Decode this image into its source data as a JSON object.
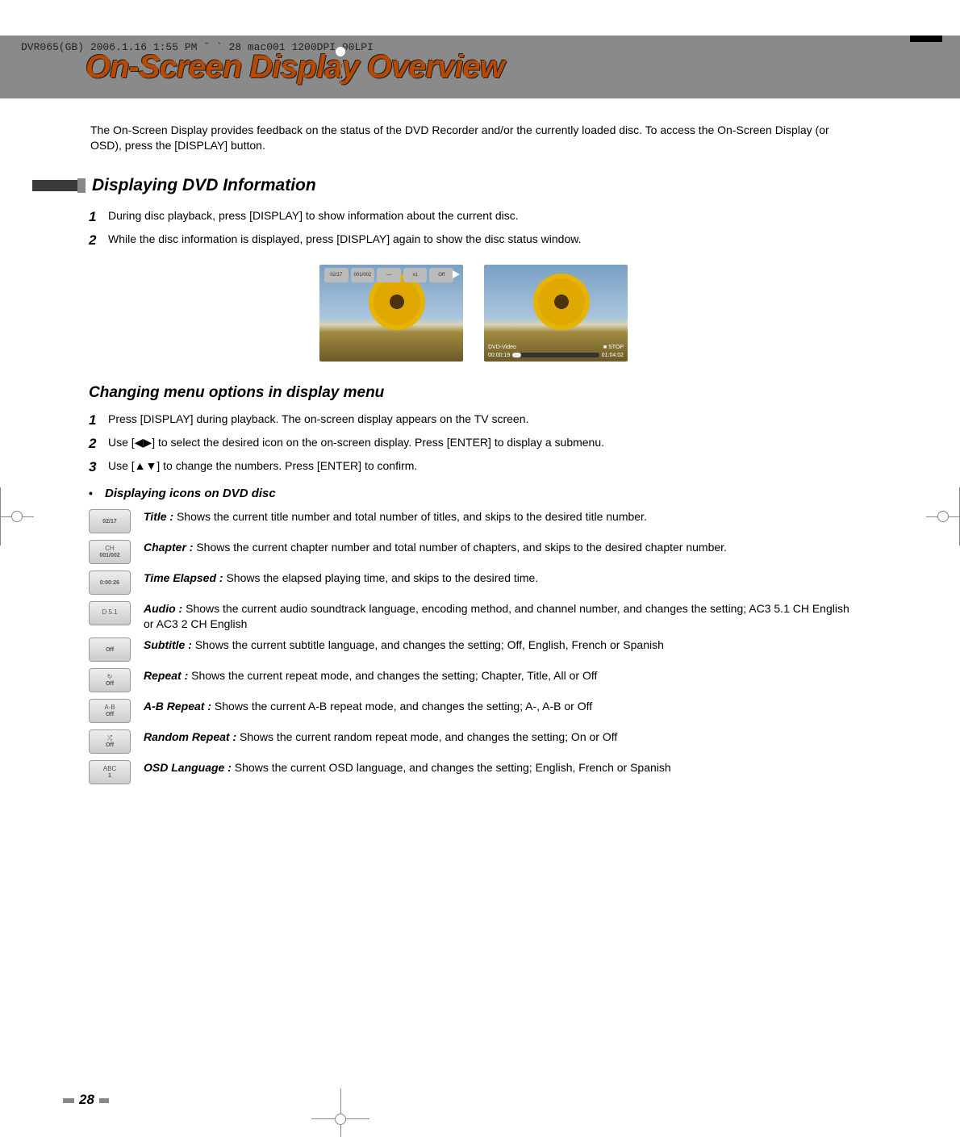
{
  "print_header": "DVR065(GB)  2006.1.16 1:55 PM  ˘   ` 28   mac001  1200DPI 90LPI",
  "title": "On-Screen Display Overview",
  "intro": "The On-Screen Display provides feedback on the status of the DVD Recorder and/or the currently loaded disc. To access the On-Screen Display (or OSD), press the [DISPLAY] button.",
  "section1": {
    "heading": "Displaying DVD Information",
    "steps": [
      {
        "num": "1",
        "text": "During disc playback, press [DISPLAY] to show information about the current disc."
      },
      {
        "num": "2",
        "text": "While the disc information is displayed, press [DISPLAY] again to show the disc status window."
      }
    ]
  },
  "screens": {
    "left_chips": [
      "02/17",
      "001/002",
      "—",
      "x1",
      "Off"
    ],
    "right_bottom_left": "DVD-Video",
    "right_bottom_right": "■ STOP",
    "right_time_left": "00:00:19",
    "right_time_right": "01:04:02"
  },
  "section2": {
    "heading": "Changing menu options in display menu",
    "steps": [
      {
        "num": "1",
        "text": "Press [DISPLAY] during playback. The on-screen display appears on the TV screen."
      },
      {
        "num": "2",
        "text": "Use [◀▶] to select the desired icon on the on-screen display. Press [ENTER] to display a submenu."
      },
      {
        "num": "3",
        "text": "Use [▲▼] to change the numbers. Press [ENTER] to confirm."
      }
    ],
    "bullet": "Displaying icons on DVD disc"
  },
  "defs": [
    {
      "icon_top": "",
      "icon_sub": "02/17",
      "term": "Title :",
      "desc": "  Shows the current title number and total number of titles, and skips to the desired title number."
    },
    {
      "icon_top": "CH",
      "icon_sub": "001/002",
      "term": "Chapter :",
      "desc": "  Shows the current chapter number and total number of chapters, and skips to the desired chapter number."
    },
    {
      "icon_top": "",
      "icon_sub": "0:00:26",
      "term": "Time Elapsed  :",
      "desc": "  Shows the elapsed playing time, and skips to the desired time."
    },
    {
      "icon_top": "D 5.1",
      "icon_sub": "",
      "term": "Audio :",
      "desc": "  Shows the current audio soundtrack language, encoding method, and channel number, and changes the setting; AC3 5.1 CH English or AC3 2 CH English"
    },
    {
      "icon_top": "",
      "icon_sub": "Off",
      "term": "Subtitle :",
      "desc": "  Shows the current subtitle language, and changes the setting; Off, English, French or Spanish"
    },
    {
      "icon_top": "↻",
      "icon_sub": "Off",
      "term": "Repeat :",
      "desc": "  Shows the current repeat mode, and changes the setting; Chapter, Title, All or Off"
    },
    {
      "icon_top": "A-B",
      "icon_sub": "Off",
      "term": "A-B Repeat :",
      "desc": "  Shows the current A-B repeat mode, and changes the setting; A-, A-B or Off"
    },
    {
      "icon_top": "⤮",
      "icon_sub": "Off",
      "term": "Random Repeat :",
      "desc": "  Shows the current random repeat mode, and changes the setting; On or Off"
    },
    {
      "icon_top": "ABC",
      "icon_sub": "1",
      "term": "OSD Language :",
      "desc": "  Shows the current OSD language, and changes the setting; English, French or Spanish"
    }
  ],
  "page_number": "28"
}
